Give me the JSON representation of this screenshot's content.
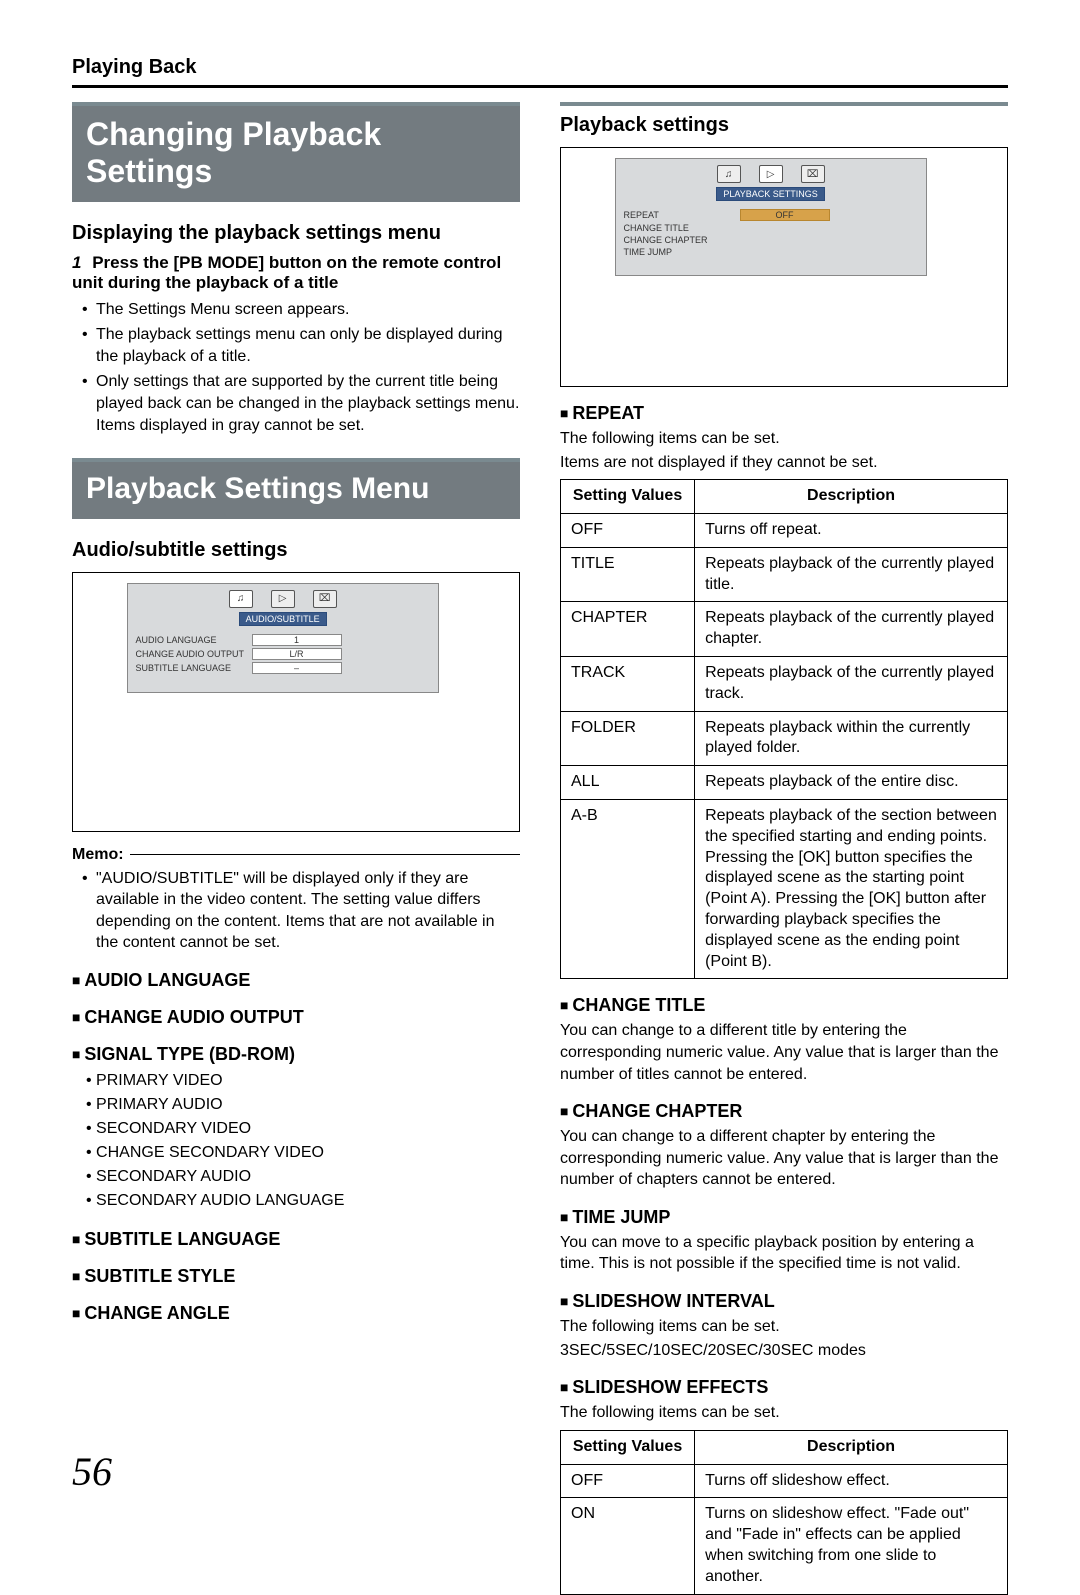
{
  "breadcrumb": "Playing Back",
  "page_number": "56",
  "left": {
    "banner1": "Changing Playback Settings",
    "subhead1": "Displaying the playback settings menu",
    "step1_num": "1",
    "step1": "Press the [PB MODE] button on the remote control unit during the playback of a title",
    "bullets1": [
      "The Settings Menu screen appears.",
      "The playback settings menu can only be displayed during the playback of a title.",
      "Only settings that are supported by the current title being played back can be changed in the playback settings menu.              Items displayed in gray cannot be set."
    ],
    "banner2": "Playback Settings Menu",
    "subhead2": "Audio/subtitle settings",
    "osd1": {
      "tab_label": "AUDIO/SUBTITLE",
      "rows": [
        {
          "k": "AUDIO LANGUAGE",
          "v": "1"
        },
        {
          "k": "CHANGE AUDIO OUTPUT",
          "v": "L/R"
        },
        {
          "k": "SUBTITLE LANGUAGE",
          "v": "–"
        }
      ]
    },
    "memo_label": "Memo:",
    "memo_text": "\"AUDIO/SUBTITLE\" will be displayed only if they are available in the video content. The setting value differs depending on the content. Items that are not available in the content cannot be set.",
    "item_audio_language": "AUDIO LANGUAGE",
    "item_change_audio_output": "CHANGE AUDIO OUTPUT",
    "item_signal_type": "SIGNAL TYPE (BD-ROM)",
    "signal_type_list": [
      "PRIMARY VIDEO",
      "PRIMARY AUDIO",
      "SECONDARY VIDEO",
      "CHANGE SECONDARY VIDEO",
      "SECONDARY AUDIO",
      "SECONDARY AUDIO LANGUAGE"
    ],
    "item_subtitle_language": "SUBTITLE LANGUAGE",
    "item_subtitle_style": "SUBTITLE STYLE",
    "item_change_angle": "CHANGE ANGLE"
  },
  "right": {
    "subhead1": "Playback settings",
    "osd2": {
      "tab_label": "PLAYBACK SETTINGS",
      "rows": [
        {
          "k": "REPEAT",
          "v": "OFF",
          "sel": true
        },
        {
          "k": "CHANGE TITLE",
          "v": ""
        },
        {
          "k": "CHANGE CHAPTER",
          "v": ""
        },
        {
          "k": "TIME JUMP",
          "v": ""
        }
      ]
    },
    "item_repeat": "REPEAT",
    "repeat_intro1": "The following items can be set.",
    "repeat_intro2": "Items are not displayed if they cannot be set.",
    "repeat_table": {
      "h1": "Setting Values",
      "h2": "Description",
      "rows": [
        {
          "v": "OFF",
          "d": "Turns off repeat."
        },
        {
          "v": "TITLE",
          "d": "Repeats playback of the currently played title."
        },
        {
          "v": "CHAPTER",
          "d": "Repeats playback of the currently played chapter."
        },
        {
          "v": "TRACK",
          "d": "Repeats playback of the currently played track."
        },
        {
          "v": "FOLDER",
          "d": "Repeats playback within the currently played folder."
        },
        {
          "v": "ALL",
          "d": "Repeats playback of the entire disc."
        },
        {
          "v": "A-B",
          "d": "Repeats playback of the section between the specified starting and ending points. Pressing the [OK] button specifies the displayed scene as the starting point (Point A). Pressing the [OK] button after forwarding playback specifies the displayed scene as the ending point (Point B)."
        }
      ]
    },
    "item_change_title": "CHANGE TITLE",
    "change_title_text": "You can change to a different title by entering the corresponding numeric value. Any value that is larger than the number of titles cannot be entered.",
    "item_change_chapter": "CHANGE CHAPTER",
    "change_chapter_text": "You can change to a different chapter by entering the corresponding numeric value. Any value that is larger than the number of chapters cannot be entered.",
    "item_time_jump": "TIME JUMP",
    "time_jump_text": "You can move to a specific playback position by entering a time. This is not possible if the specified time is not valid.",
    "item_slideshow_interval": "SLIDESHOW INTERVAL",
    "slideshow_interval_text1": "The following items can be set.",
    "slideshow_interval_text2": "3SEC/5SEC/10SEC/20SEC/30SEC modes",
    "item_slideshow_effects": "SLIDESHOW EFFECTS",
    "slideshow_effects_text": "The following items can be set.",
    "effects_table": {
      "h1": "Setting Values",
      "h2": "Description",
      "rows": [
        {
          "v": "OFF",
          "d": "Turns off slideshow effect."
        },
        {
          "v": "ON",
          "d": "Turns on slideshow effect. \"Fade out\" and \"Fade in\" effects can be applied when switching from one slide to another."
        }
      ]
    }
  }
}
